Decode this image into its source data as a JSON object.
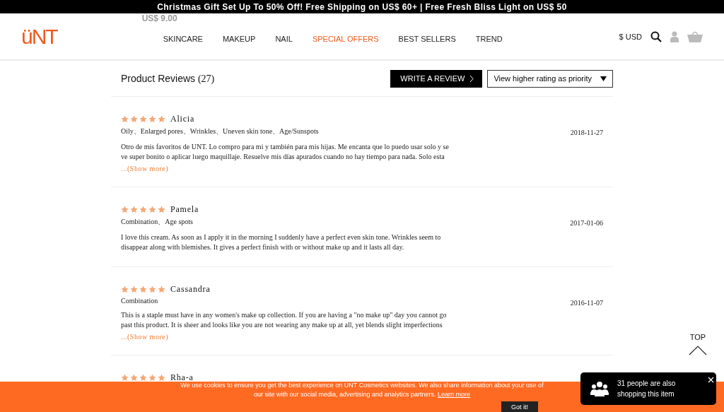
{
  "promo_bar": {
    "text": "Christmas Gift Set Up To 50% Off! Free Shipping on US$ 60+ | Free Fresh Bliss Light on US$ 50"
  },
  "header": {
    "logo": "üNT",
    "ghost_price": "US$ 9.00",
    "nav": [
      {
        "label": "SKINCARE",
        "selected": false
      },
      {
        "label": "MAKEUP",
        "selected": false
      },
      {
        "label": "NAIL",
        "selected": false
      },
      {
        "label": "SPECIAL OFFERS",
        "selected": true
      },
      {
        "label": "BEST SELLERS",
        "selected": false
      },
      {
        "label": "TREND",
        "selected": false
      }
    ],
    "currency": "$ USD"
  },
  "reviews_header": {
    "title": "Product Reviews",
    "count": "(27)",
    "write_button": "WRITE A REVIEW",
    "sort": "View higher rating as priority"
  },
  "reviews": [
    {
      "stars": 5,
      "name": "Alicia",
      "tags": "Oily、Enlarged pores、Wrinkles、Uneven skin tone、Age/Sunspots",
      "text": "Otro de mis favoritos de UNT. Lo compro para mi y también para mis hijas. Me encanta que lo puedo usar solo y se ve super bonito o aplicar luego maquillaje. Resuelve mis días apurados cuando no hay tiempo para nada. Solo esta",
      "show_more": "...(Show more)",
      "date": "2018-11-27"
    },
    {
      "stars": 5,
      "name": "Pamela",
      "tags": "Combination、Age spots",
      "text": "I love this cream. As soon as I apply it in the morning I suddenly have a perfect even skin tone. Wrinkles seem to disappear along with blemishes. It gives a perfect finish with or without make up and it lasts all day.",
      "date": "2017-01-06"
    },
    {
      "stars": 5,
      "name": "Cassandra",
      "tags": "Combination",
      "text": "This is a staple must have in any women's make up collection. If you are having a \"no make up\" day you cannot go past this product. It is sheer and looks like you are not wearing any make up at all, yet blends slight imperfections",
      "show_more": "...(Show more)",
      "date": "2016-11-07"
    },
    {
      "stars": 5,
      "name": "Rha-a"
    }
  ],
  "top_button": "TOP",
  "cookie_bar": {
    "text": "We use cookies to ensure you get the best experience on UNT Cosmetics websites. We also share information about your use of our site with our social media, advertising and analytics partners.",
    "link": "Learn more",
    "button": "Got it!"
  },
  "shopping_popup": {
    "text": "31 people are also shopping this item"
  }
}
